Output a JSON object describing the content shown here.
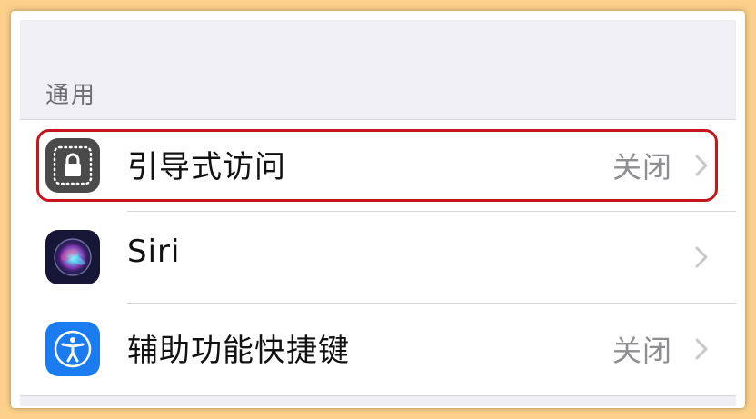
{
  "section": {
    "title": "通用"
  },
  "rows": [
    {
      "label": "引导式访问",
      "value": "关闭",
      "icon": "guided-access-lock-icon",
      "icon_color": "#4a4a4a"
    },
    {
      "label": "Siri",
      "value": "",
      "icon": "siri-icon",
      "icon_color": "#1a1a3a"
    },
    {
      "label": "辅助功能快捷键",
      "value": "关闭",
      "icon": "accessibility-icon",
      "icon_color": "#1a7cf0"
    }
  ],
  "highlight_color": "#c4161c"
}
